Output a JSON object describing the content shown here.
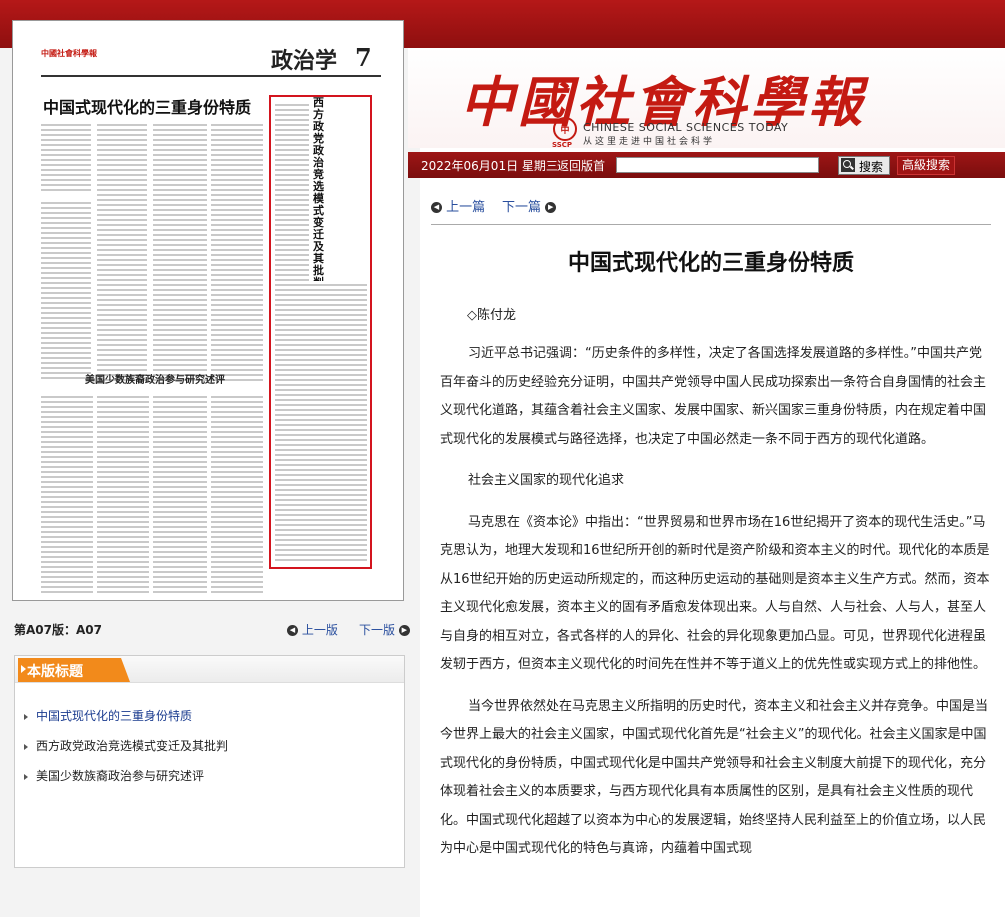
{
  "masthead": {
    "cn_title": "中國社會科學報",
    "en_title": "CHINESE  SOCIAL  SCIENCES  TODAY",
    "sub_title": "从这里走进中国社会科学",
    "sscp": "SSCP"
  },
  "nav": {
    "date": "2022年06月01日 星期三",
    "home_link": "返回版首",
    "search_placeholder": "",
    "search_button": "搜索",
    "advanced_search": "高級搜索"
  },
  "paper_page": {
    "masthead_small": "中國社會科學報",
    "section": "政治学",
    "page_num": "7",
    "headline": "中国式现代化的三重身份特质",
    "vertical_title": "西方政党政治竞选模式变迁及其批判",
    "second_headline": "美国少数族裔政治参与研究述评"
  },
  "page_nav": {
    "page_info": "第A07版：A07",
    "prev": "上一版",
    "next": "下一版"
  },
  "headlines_box": {
    "title": "本版标题",
    "items": [
      "中国式现代化的三重身份特质",
      "西方政党政治竞选模式变迁及其批判",
      "美国少数族裔政治参与研究述评"
    ]
  },
  "article": {
    "prev": "上一篇",
    "next": "下一篇",
    "title": "中国式现代化的三重身份特质",
    "author": "◇陈付龙",
    "paragraphs": [
      "习近平总书记强调：“历史条件的多样性，决定了各国选择发展道路的多样性。”中国共产党百年奋斗的历史经验充分证明，中国共产党领导中国人民成功探索出一条符合自身国情的社会主义现代化道路，其蕴含着社会主义国家、发展中国家、新兴国家三重身份特质，内在规定着中国式现代化的发展模式与路径选择，也决定了中国必然走一条不同于西方的现代化道路。",
      "社会主义国家的现代化追求",
      "马克思在《资本论》中指出：“世界贸易和世界市场在16世纪揭开了资本的现代生活史。”马克思认为，地理大发现和16世纪所开创的新时代是资产阶级和资本主义的时代。现代化的本质是从16世纪开始的历史运动所规定的，而这种历史运动的基础则是资本主义生产方式。然而，资本主义现代化愈发展，资本主义的固有矛盾愈发体现出来。人与自然、人与社会、人与人，甚至人与自身的相互对立，各式各样的人的异化、社会的异化现象更加凸显。可见，世界现代化进程虽发轫于西方，但资本主义现代化的时间先在性并不等于道义上的优先性或实现方式上的排他性。",
      "当今世界依然处在马克思主义所指明的历史时代，资本主义和社会主义并存竞争。中国是当今世界上最大的社会主义国家，中国式现代化首先是“社会主义”的现代化。社会主义国家是中国式现代化的身份特质，中国式现代化是中国共产党领导和社会主义制度大前提下的现代化，充分体现着社会主义的本质要求，与西方现代化具有本质属性的区别，是具有社会主义性质的现代化。中国式现代化超越了以资本为中心的发展逻辑，始终坚持人民利益至上的价值立场，以人民为中心是中国式现代化的特色与真谛，内蕴着中国式现"
    ]
  }
}
